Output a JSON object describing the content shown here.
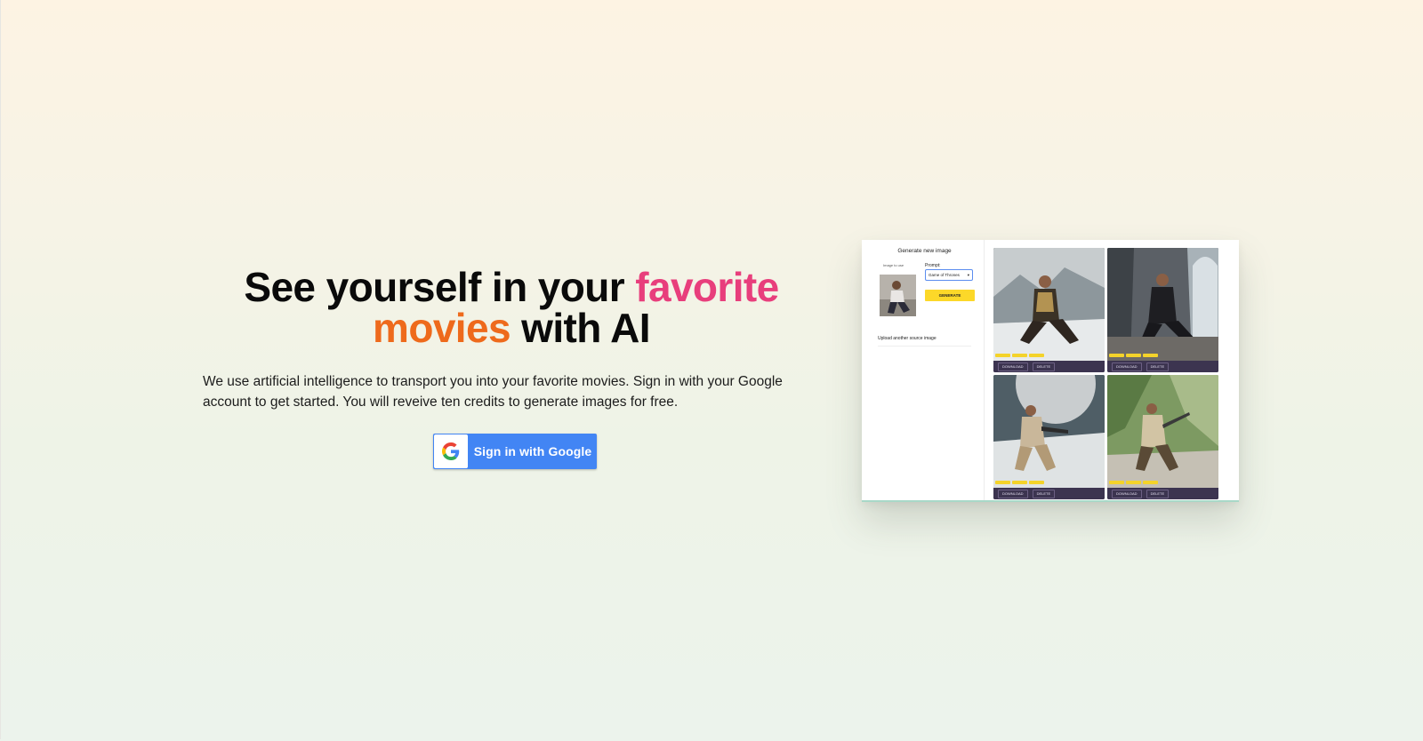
{
  "hero": {
    "headline_part1": "See yourself in your ",
    "headline_highlight1": "favorite",
    "headline_highlight2": "movies",
    "headline_part2": " with AI",
    "description": "We use artificial intelligence to transport you into your favorite movies. Sign in with your Google account to get started. You will reveive ten credits to generate images for free.",
    "signin_label": "Sign in with Google",
    "signin_icon": "google-g-icon"
  },
  "preview": {
    "title": "Generate new image",
    "image_label": "Image to use",
    "prompt_label": "Prompt:",
    "prompt_value": "Game of Thrones",
    "generate_label": "GENERATE",
    "upload_link": "Upload another source image",
    "cards": [
      {
        "download": "DOWNLOAD",
        "delete": "DELETE"
      },
      {
        "download": "DOWNLOAD",
        "delete": "DELETE"
      },
      {
        "download": "DOWNLOAD",
        "delete": "DELETE"
      },
      {
        "download": "DOWNLOAD",
        "delete": "DELETE"
      }
    ]
  },
  "colors": {
    "accent_pink": "#e83e7c",
    "accent_orange": "#ee6a1c",
    "google_blue": "#4285f4",
    "generate_yellow": "#fcd829",
    "card_bar": "#3c3450"
  }
}
